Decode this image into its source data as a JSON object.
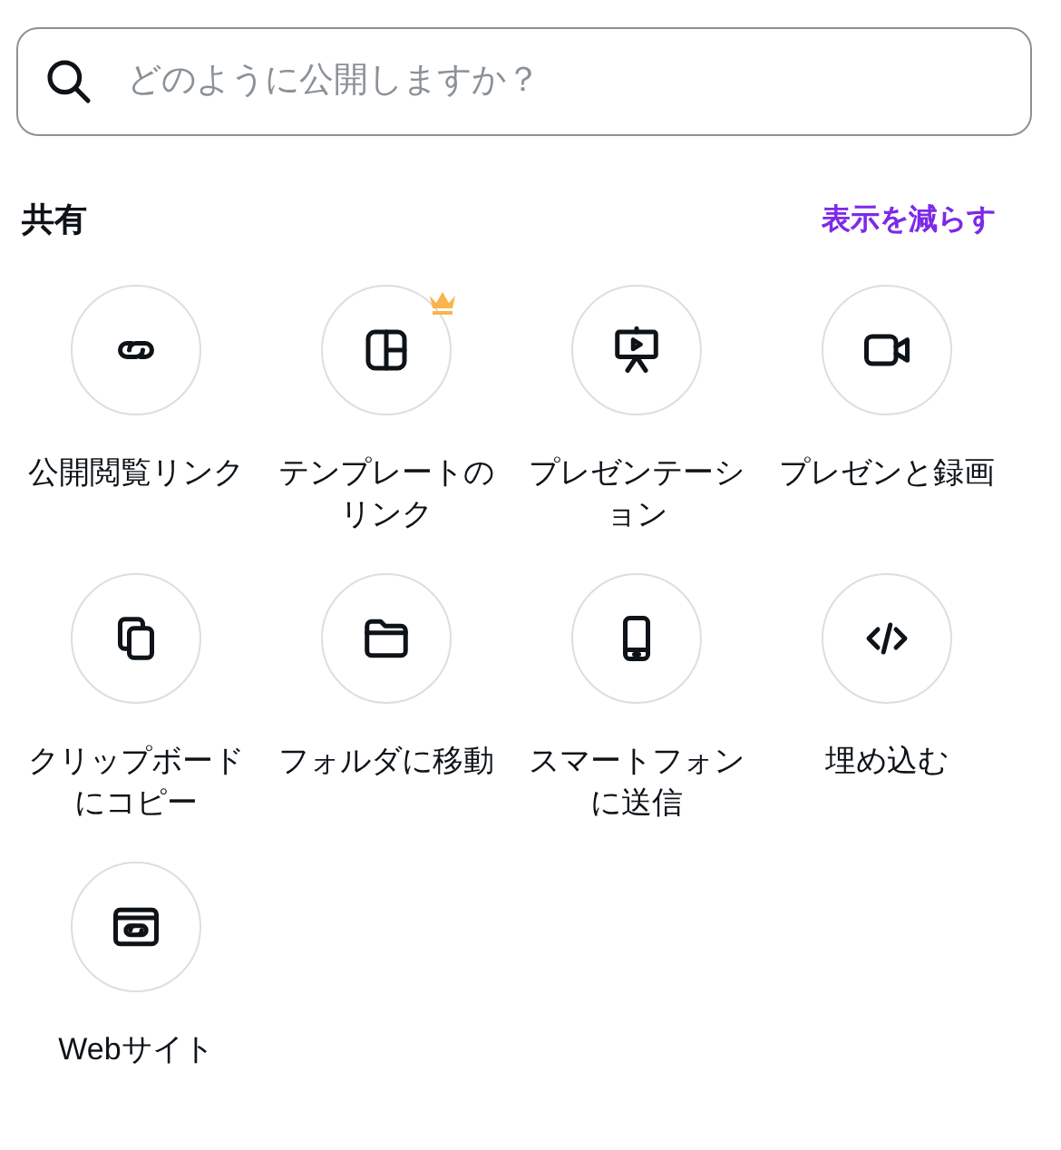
{
  "search": {
    "placeholder": "どのように公開しますか？"
  },
  "section": {
    "title": "共有",
    "toggle": "表示を減らす"
  },
  "items": [
    {
      "kind": "link",
      "label": "公開閲覧リンク",
      "premium": false
    },
    {
      "kind": "template",
      "label": "テンプレートのリンク",
      "premium": true
    },
    {
      "kind": "present",
      "label": "プレゼンテーション",
      "premium": false
    },
    {
      "kind": "video",
      "label": "プレゼンと録画",
      "premium": false
    },
    {
      "kind": "copy",
      "label": "クリップボードにコピー",
      "premium": false
    },
    {
      "kind": "folder",
      "label": "フォルダに移動",
      "premium": false
    },
    {
      "kind": "phone",
      "label": "スマートフォンに送信",
      "premium": false
    },
    {
      "kind": "embed",
      "label": "埋め込む",
      "premium": false
    },
    {
      "kind": "website",
      "label": "Webサイト",
      "premium": false
    }
  ]
}
